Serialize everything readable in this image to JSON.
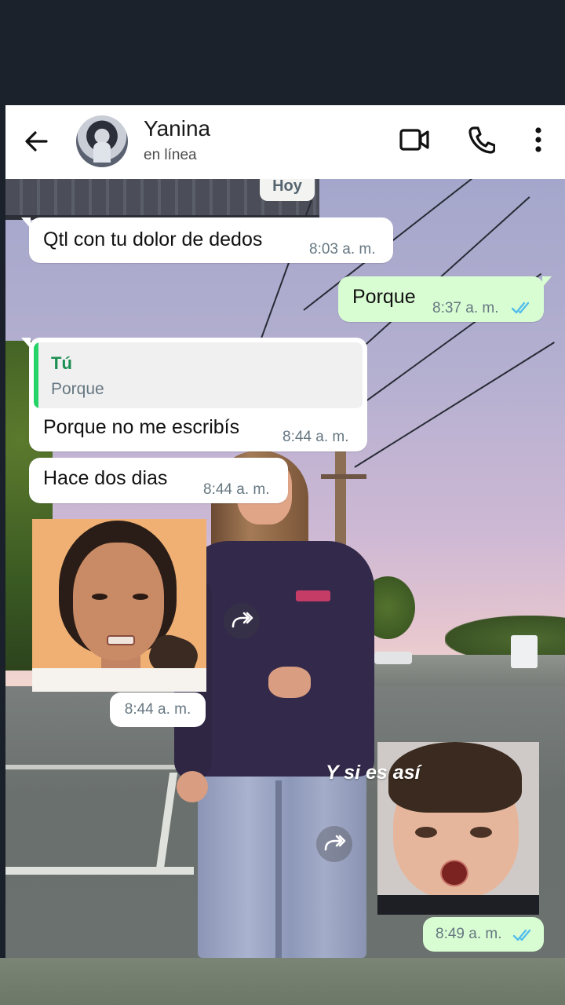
{
  "header": {
    "contact_name": "Yanina",
    "status": "en línea",
    "icons": [
      "back-arrow-icon",
      "video-call-icon",
      "phone-icon",
      "more-vert-icon"
    ]
  },
  "chat": {
    "date_label": "Hoy",
    "messages": [
      {
        "direction": "incoming",
        "text": "Qtl con tu dolor de dedos",
        "time": "8:03 a. m."
      },
      {
        "direction": "outgoing",
        "text": "Porque",
        "time": "8:37 a. m.",
        "status": "read"
      },
      {
        "direction": "incoming",
        "reply_author": "Tú",
        "reply_text": "Porque",
        "text": "Porque no me escribís",
        "time": "8:44 a. m."
      },
      {
        "direction": "incoming",
        "text": "Hace dos dias",
        "time": "8:44 a. m."
      },
      {
        "direction": "incoming",
        "type": "sticker",
        "time": "8:44 a. m."
      },
      {
        "direction": "outgoing",
        "type": "sticker",
        "caption": "Y si es así",
        "time": "8:49 a. m.",
        "status": "read"
      }
    ]
  },
  "colors": {
    "incoming_bubble": "#ffffff",
    "outgoing_bubble": "#d9fdd3",
    "read_tick": "#53bdeb",
    "reply_accent": "#25d366",
    "timestamp": "#667781"
  }
}
